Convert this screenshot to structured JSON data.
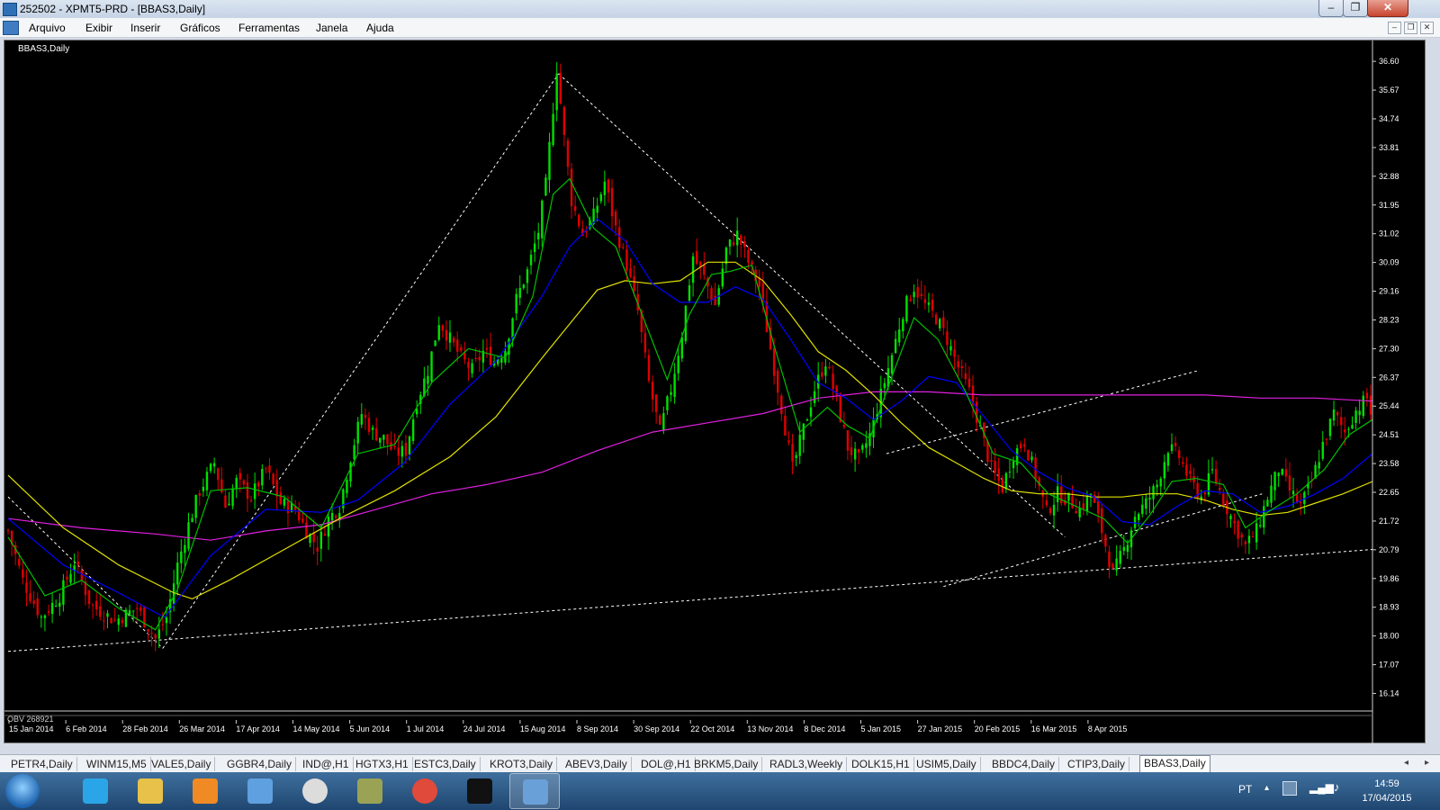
{
  "window": {
    "title": "252502 - XPMT5-PRD - [BBAS3,Daily]",
    "controls": {
      "minimize": "–",
      "restore": "❐",
      "close": "✕"
    }
  },
  "menu": {
    "items": [
      "Arquivo",
      "Exibir",
      "Inserir",
      "Gráficos",
      "Ferramentas",
      "Janela",
      "Ajuda"
    ],
    "mdi_controls": {
      "minimize": "–",
      "restore": "❐",
      "close": "✕"
    }
  },
  "chart_data": {
    "type": "candlestick",
    "title": "BBAS3,Daily",
    "indicator_label": "OBV 268921",
    "y_ticks": [
      "36.60",
      "35.67",
      "34.74",
      "33.81",
      "32.88",
      "31.95",
      "31.02",
      "30.09",
      "29.16",
      "28.23",
      "27.30",
      "26.37",
      "25.44",
      "24.51",
      "23.58",
      "22.65",
      "21.72",
      "20.79",
      "19.86",
      "18.93",
      "18.00",
      "17.07",
      "16.14"
    ],
    "ylim": [
      15.6,
      37.1
    ],
    "x_ticks": [
      "15 Jan 2014",
      "6 Feb 2014",
      "28 Feb 2014",
      "26 Mar 2014",
      "17 Apr 2014",
      "14 May 2014",
      "5 Jun 2014",
      "1 Jul 2014",
      "24 Jul 2014",
      "15 Aug 2014",
      "8 Sep 2014",
      "30 Sep 2014",
      "22 Oct 2014",
      "13 Nov 2014",
      "8 Dec 2014",
      "5 Jan 2015",
      "27 Jan 2015",
      "20 Feb 2015",
      "16 Mar 2015",
      "8 Apr 2015"
    ],
    "grid": false,
    "colors": {
      "background": "#000000",
      "bull": "#00e000",
      "bear": "#e00000",
      "ma_fast": "#00c000",
      "ma_mid": "#0000ff",
      "ma_slow": "#e0e000",
      "ma_long": "#e020e0",
      "trendline": "#ffffff"
    },
    "close_path": [
      [
        0,
        21.4
      ],
      [
        8,
        19.8
      ],
      [
        18,
        18.6
      ],
      [
        28,
        19.3
      ],
      [
        36,
        20.4
      ],
      [
        45,
        19.0
      ],
      [
        58,
        18.5
      ],
      [
        70,
        18.9
      ],
      [
        80,
        17.9
      ],
      [
        86,
        18.6
      ],
      [
        92,
        20.3
      ],
      [
        98,
        21.6
      ],
      [
        104,
        22.7
      ],
      [
        112,
        23.6
      ],
      [
        118,
        22.2
      ],
      [
        124,
        23.0
      ],
      [
        132,
        22.5
      ],
      [
        140,
        23.4
      ],
      [
        148,
        22.3
      ],
      [
        156,
        22.1
      ],
      [
        162,
        21.4
      ],
      [
        168,
        20.9
      ],
      [
        174,
        21.8
      ],
      [
        180,
        22.2
      ],
      [
        186,
        23.8
      ],
      [
        192,
        25.2
      ],
      [
        198,
        24.6
      ],
      [
        204,
        24.4
      ],
      [
        210,
        23.9
      ],
      [
        216,
        24.0
      ],
      [
        222,
        25.6
      ],
      [
        228,
        26.6
      ],
      [
        234,
        28.2
      ],
      [
        240,
        27.6
      ],
      [
        246,
        27.0
      ],
      [
        252,
        26.6
      ],
      [
        258,
        27.2
      ],
      [
        264,
        26.9
      ],
      [
        270,
        27.3
      ],
      [
        276,
        28.9
      ],
      [
        282,
        29.8
      ],
      [
        288,
        31.1
      ],
      [
        292,
        32.6
      ],
      [
        296,
        35.1
      ],
      [
        298,
        36.4
      ],
      [
        302,
        34.1
      ],
      [
        306,
        32.1
      ],
      [
        312,
        31.0
      ],
      [
        318,
        31.6
      ],
      [
        324,
        32.7
      ],
      [
        330,
        31.2
      ],
      [
        336,
        30.0
      ],
      [
        342,
        28.5
      ],
      [
        348,
        26.2
      ],
      [
        354,
        24.6
      ],
      [
        360,
        26.0
      ],
      [
        366,
        27.8
      ],
      [
        372,
        30.3
      ],
      [
        378,
        29.6
      ],
      [
        384,
        28.7
      ],
      [
        390,
        30.5
      ],
      [
        396,
        31.0
      ],
      [
        402,
        30.1
      ],
      [
        408,
        29.3
      ],
      [
        414,
        27.3
      ],
      [
        420,
        25.4
      ],
      [
        426,
        23.4
      ],
      [
        432,
        24.7
      ],
      [
        438,
        26.0
      ],
      [
        444,
        26.9
      ],
      [
        450,
        25.6
      ],
      [
        456,
        24.1
      ],
      [
        462,
        23.7
      ],
      [
        468,
        24.5
      ],
      [
        474,
        25.8
      ],
      [
        480,
        27.1
      ],
      [
        486,
        28.5
      ],
      [
        492,
        29.3
      ],
      [
        498,
        28.7
      ],
      [
        504,
        28.3
      ],
      [
        510,
        27.6
      ],
      [
        516,
        26.7
      ],
      [
        522,
        25.9
      ],
      [
        528,
        24.7
      ],
      [
        534,
        23.4
      ],
      [
        540,
        22.8
      ],
      [
        546,
        23.9
      ],
      [
        552,
        24.3
      ],
      [
        558,
        23.2
      ],
      [
        564,
        22.0
      ],
      [
        570,
        22.6
      ],
      [
        576,
        22.4
      ],
      [
        582,
        22.1
      ],
      [
        588,
        22.6
      ],
      [
        594,
        21.4
      ],
      [
        600,
        20.0
      ],
      [
        606,
        20.8
      ],
      [
        612,
        21.9
      ],
      [
        618,
        22.3
      ],
      [
        624,
        22.9
      ],
      [
        630,
        24.1
      ],
      [
        636,
        23.8
      ],
      [
        642,
        23.0
      ],
      [
        648,
        22.5
      ],
      [
        654,
        23.3
      ],
      [
        660,
        22.4
      ],
      [
        666,
        21.6
      ],
      [
        672,
        20.9
      ],
      [
        678,
        21.4
      ],
      [
        684,
        22.5
      ],
      [
        690,
        23.4
      ],
      [
        696,
        22.7
      ],
      [
        702,
        22.2
      ],
      [
        708,
        23.0
      ],
      [
        714,
        24.2
      ],
      [
        720,
        25.2
      ],
      [
        726,
        24.6
      ],
      [
        732,
        25.3
      ],
      [
        738,
        25.7
      ],
      [
        741,
        25.0
      ]
    ],
    "ma_fast": [
      [
        0,
        21.2
      ],
      [
        20,
        19.3
      ],
      [
        40,
        19.8
      ],
      [
        60,
        18.9
      ],
      [
        80,
        18.2
      ],
      [
        92,
        19.5
      ],
      [
        110,
        22.7
      ],
      [
        130,
        22.8
      ],
      [
        150,
        22.5
      ],
      [
        170,
        21.5
      ],
      [
        190,
        23.9
      ],
      [
        210,
        24.2
      ],
      [
        230,
        26.2
      ],
      [
        250,
        27.3
      ],
      [
        270,
        27.0
      ],
      [
        285,
        29.0
      ],
      [
        296,
        32.3
      ],
      [
        305,
        32.8
      ],
      [
        318,
        31.2
      ],
      [
        330,
        30.6
      ],
      [
        345,
        28.3
      ],
      [
        358,
        26.3
      ],
      [
        370,
        28.4
      ],
      [
        382,
        29.7
      ],
      [
        392,
        29.8
      ],
      [
        404,
        30.0
      ],
      [
        416,
        27.4
      ],
      [
        430,
        24.6
      ],
      [
        445,
        25.4
      ],
      [
        456,
        24.8
      ],
      [
        468,
        24.4
      ],
      [
        480,
        26.4
      ],
      [
        492,
        28.3
      ],
      [
        505,
        27.6
      ],
      [
        520,
        25.9
      ],
      [
        535,
        23.9
      ],
      [
        550,
        23.6
      ],
      [
        565,
        22.6
      ],
      [
        580,
        22.2
      ],
      [
        595,
        21.8
      ],
      [
        608,
        21.0
      ],
      [
        620,
        21.9
      ],
      [
        632,
        23.0
      ],
      [
        645,
        23.1
      ],
      [
        660,
        22.9
      ],
      [
        672,
        21.5
      ],
      [
        684,
        22.0
      ],
      [
        700,
        22.6
      ],
      [
        715,
        23.4
      ],
      [
        728,
        24.5
      ],
      [
        741,
        25.0
      ]
    ],
    "ma_mid": [
      [
        0,
        21.8
      ],
      [
        30,
        20.3
      ],
      [
        60,
        19.4
      ],
      [
        85,
        18.6
      ],
      [
        110,
        20.6
      ],
      [
        140,
        22.1
      ],
      [
        170,
        22.0
      ],
      [
        190,
        22.4
      ],
      [
        215,
        23.6
      ],
      [
        240,
        25.5
      ],
      [
        265,
        26.9
      ],
      [
        290,
        29.0
      ],
      [
        305,
        30.6
      ],
      [
        320,
        31.5
      ],
      [
        335,
        30.8
      ],
      [
        350,
        29.4
      ],
      [
        365,
        28.8
      ],
      [
        380,
        28.8
      ],
      [
        395,
        29.3
      ],
      [
        410,
        28.9
      ],
      [
        425,
        27.6
      ],
      [
        440,
        26.2
      ],
      [
        455,
        25.7
      ],
      [
        470,
        25.0
      ],
      [
        485,
        25.6
      ],
      [
        500,
        26.4
      ],
      [
        515,
        26.2
      ],
      [
        530,
        25.1
      ],
      [
        545,
        24.0
      ],
      [
        560,
        23.3
      ],
      [
        575,
        22.8
      ],
      [
        590,
        22.5
      ],
      [
        605,
        21.7
      ],
      [
        620,
        21.6
      ],
      [
        635,
        22.2
      ],
      [
        650,
        22.7
      ],
      [
        665,
        22.6
      ],
      [
        680,
        22.0
      ],
      [
        695,
        22.2
      ],
      [
        710,
        22.6
      ],
      [
        725,
        23.1
      ],
      [
        741,
        23.9
      ]
    ],
    "ma_slow": [
      [
        0,
        23.2
      ],
      [
        30,
        21.5
      ],
      [
        60,
        20.3
      ],
      [
        90,
        19.4
      ],
      [
        100,
        19.2
      ],
      [
        120,
        19.8
      ],
      [
        150,
        20.8
      ],
      [
        180,
        21.8
      ],
      [
        210,
        22.7
      ],
      [
        240,
        23.8
      ],
      [
        265,
        25.1
      ],
      [
        290,
        27.0
      ],
      [
        305,
        28.1
      ],
      [
        320,
        29.2
      ],
      [
        335,
        29.5
      ],
      [
        350,
        29.4
      ],
      [
        365,
        29.5
      ],
      [
        380,
        30.1
      ],
      [
        395,
        30.1
      ],
      [
        410,
        29.5
      ],
      [
        425,
        28.4
      ],
      [
        440,
        27.2
      ],
      [
        455,
        26.6
      ],
      [
        470,
        25.8
      ],
      [
        485,
        24.9
      ],
      [
        500,
        24.1
      ],
      [
        515,
        23.6
      ],
      [
        530,
        23.1
      ],
      [
        545,
        22.7
      ],
      [
        560,
        22.6
      ],
      [
        575,
        22.6
      ],
      [
        590,
        22.5
      ],
      [
        605,
        22.5
      ],
      [
        620,
        22.6
      ],
      [
        635,
        22.6
      ],
      [
        650,
        22.4
      ],
      [
        665,
        22.1
      ],
      [
        680,
        21.9
      ],
      [
        695,
        22.0
      ],
      [
        710,
        22.3
      ],
      [
        725,
        22.6
      ],
      [
        741,
        23.0
      ]
    ],
    "ma_long": [
      [
        0,
        21.8
      ],
      [
        40,
        21.5
      ],
      [
        80,
        21.3
      ],
      [
        110,
        21.1
      ],
      [
        140,
        21.4
      ],
      [
        170,
        21.6
      ],
      [
        200,
        22.1
      ],
      [
        230,
        22.6
      ],
      [
        260,
        22.9
      ],
      [
        290,
        23.3
      ],
      [
        320,
        24.0
      ],
      [
        350,
        24.6
      ],
      [
        380,
        24.9
      ],
      [
        410,
        25.2
      ],
      [
        440,
        25.7
      ],
      [
        470,
        25.9
      ],
      [
        500,
        25.9
      ],
      [
        530,
        25.8
      ],
      [
        560,
        25.8
      ],
      [
        590,
        25.8
      ],
      [
        620,
        25.8
      ],
      [
        650,
        25.8
      ],
      [
        680,
        25.7
      ],
      [
        710,
        25.7
      ],
      [
        741,
        25.6
      ]
    ],
    "trendlines": [
      {
        "from": [
          0,
          17.5
        ],
        "to": [
          741,
          20.8
        ]
      },
      {
        "from": [
          0,
          22.5
        ],
        "to": [
          84,
          17.6
        ]
      },
      {
        "from": [
          84,
          17.6
        ],
        "to": [
          299,
          36.2
        ]
      },
      {
        "from": [
          299,
          36.2
        ],
        "to": [
          574,
          21.2
        ]
      },
      {
        "from": [
          508,
          19.6
        ],
        "to": [
          681,
          22.6
        ]
      },
      {
        "from": [
          477,
          23.9
        ],
        "to": [
          647,
          26.6
        ]
      }
    ]
  },
  "symbol_tabs": {
    "items": [
      "PETR4,Daily",
      "WINM15,M5",
      "VALE5,Daily",
      "GGBR4,Daily",
      "IND@,H1",
      "HGTX3,H1",
      "ESTC3,Daily",
      "KROT3,Daily",
      "ABEV3,Daily",
      "DOL@,H1",
      "BRKM5,Daily",
      "RADL3,Weekly",
      "DOLK15,H1",
      "USIM5,Daily",
      "BBDC4,Daily",
      "CTIP3,Daily",
      "BBAS3,Daily"
    ],
    "active_index": 16,
    "scroll_left": "◂",
    "scroll_right": "▸"
  },
  "taskbar": {
    "apps": [
      "internet-explorer-icon",
      "file-explorer-icon",
      "media-player-icon",
      "network-icon",
      "hp-icon",
      "archive-icon",
      "chrome-icon",
      "xp-app-icon",
      "metatrader-icon"
    ],
    "active_app": "metatrader-icon",
    "language": "PT",
    "time": "14:59",
    "date": "17/04/2015"
  }
}
